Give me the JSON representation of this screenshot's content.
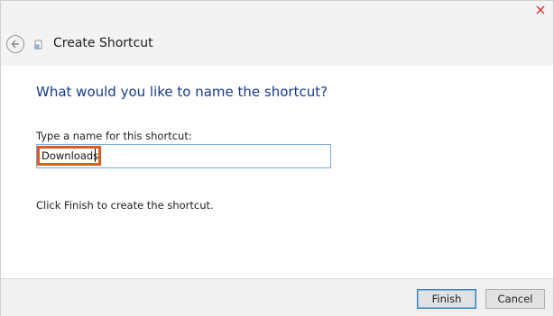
{
  "window": {
    "title": "Create Shortcut"
  },
  "page": {
    "heading": "What would you like to name the shortcut?",
    "field_label": "Type a name for this shortcut:",
    "name_value": "Downloads",
    "hint": "Click Finish to create the shortcut."
  },
  "buttons": {
    "finish": "Finish",
    "cancel": "Cancel"
  },
  "icons": {
    "close": "close-icon",
    "back": "back-arrow-icon",
    "shortcut": "shortcut-icon"
  },
  "colors": {
    "heading": "#17398a",
    "highlight": "#e05a1e",
    "close": "#d13438",
    "input_border": "#7fa9d6"
  }
}
